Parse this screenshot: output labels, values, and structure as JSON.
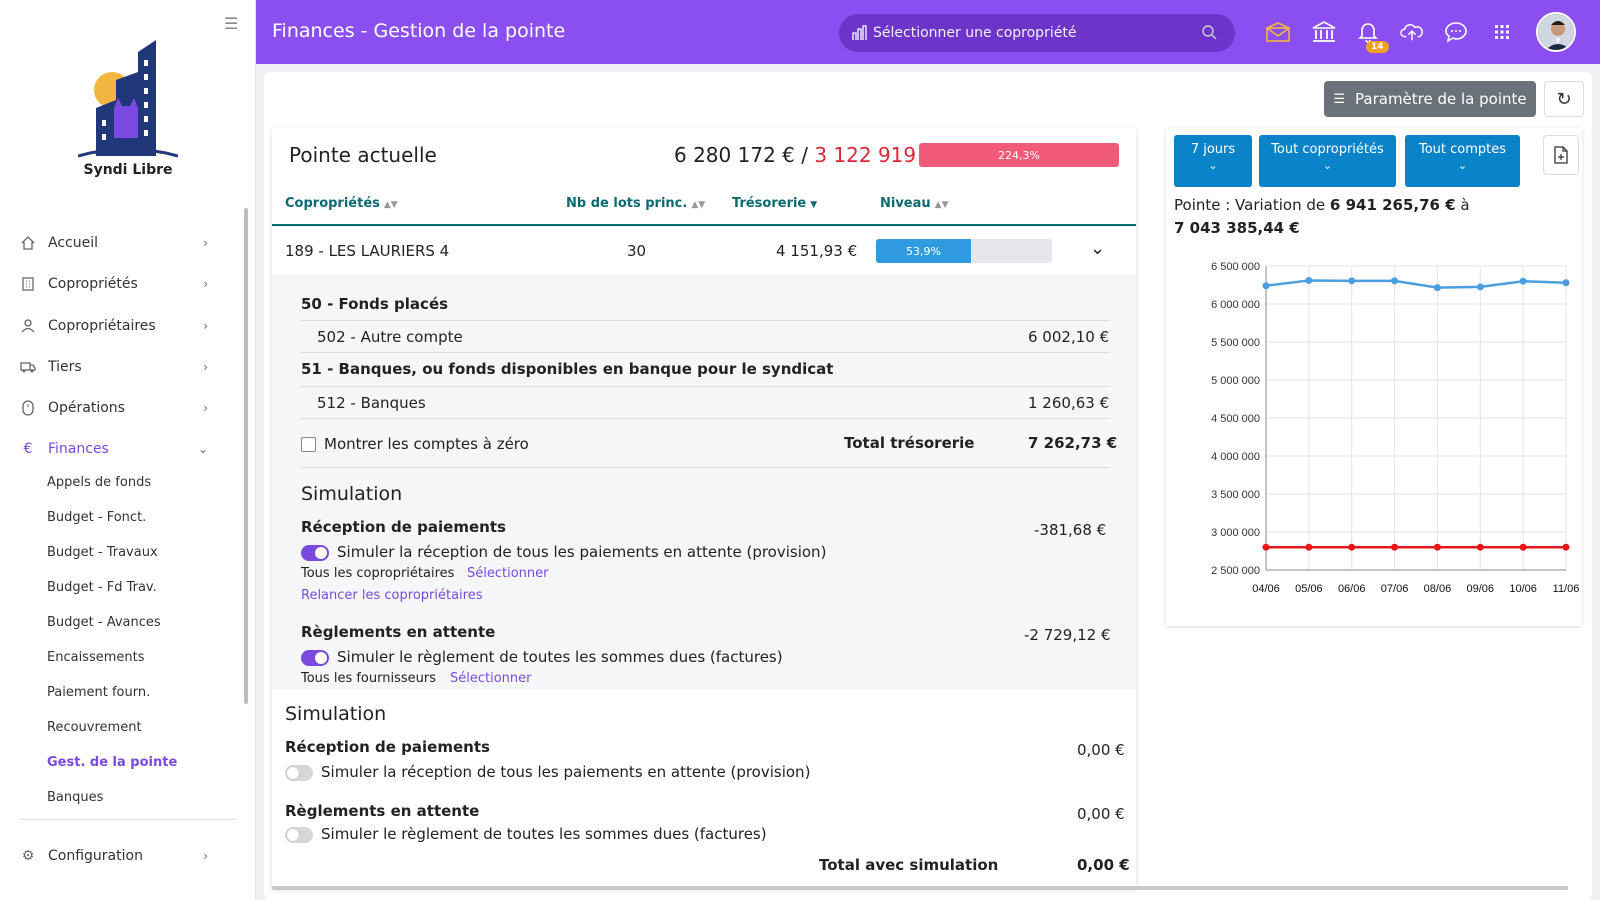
{
  "sidebar": {
    "brand": "Syndi Libre",
    "items": [
      {
        "label": "Accueil",
        "icon": "home-icon"
      },
      {
        "label": "Copropriétés",
        "icon": "building-icon"
      },
      {
        "label": "Copropriétaires",
        "icon": "user-icon"
      },
      {
        "label": "Tiers",
        "icon": "truck-icon"
      },
      {
        "label": "Opérations",
        "icon": "mouse-icon"
      },
      {
        "label": "Finances",
        "icon": "euro-icon"
      }
    ],
    "finances_sub": [
      "Appels de fonds",
      "Budget - Fonct.",
      "Budget - Travaux",
      "Budget - Fd Trav.",
      "Budget - Avances",
      "Encaissements",
      "Paiement fourn.",
      "Recouvrement",
      "Gest. de la pointe",
      "Banques"
    ],
    "config": "Configuration"
  },
  "header": {
    "title": "Finances - Gestion de la pointe",
    "search_placeholder": "Sélectionner une copropriété",
    "notif_count": "14"
  },
  "toolbar": {
    "param_label": "Paramètre de la pointe"
  },
  "pointe": {
    "title": "Pointe actuelle",
    "total_black": "6 280 172 €",
    "sep": " / ",
    "total_red": "3 122 919 €",
    "percent": "224,3%",
    "percent_value": 224.3
  },
  "table": {
    "headers": [
      "Copropriétés",
      "Nb de lots princ.",
      "Trésorerie",
      "Niveau"
    ],
    "row": {
      "name": "189 - LES LAURIERS 4",
      "lots": "30",
      "tresorerie": "4 151,93 €",
      "niveau": "53,9%",
      "niveau_value": 53.9
    }
  },
  "detail": {
    "group1": "50 - Fonds placés",
    "acc1": "502 - Autre compte",
    "acc1_val": "6 002,10 €",
    "group2": "51 - Banques, ou fonds disponibles en banque pour le syndicat",
    "acc2": "512 - Banques",
    "acc2_val": "1 260,63 €",
    "show_zero": "Montrer les comptes à zéro",
    "total_label": "Total trésorerie",
    "total_val": "7 262,73 €"
  },
  "sim_inner": {
    "title": "Simulation",
    "recv_title": "Réception de paiements",
    "recv_val": "-381,68 €",
    "recv_toggle": "Simuler la réception de tous les paiements en attente (provision)",
    "recv_scope": "Tous les copropriétaires",
    "select": "Sélectionner",
    "relance": "Relancer les copropriétaires",
    "pay_title": "Règlements en attente",
    "pay_val": "-2 729,12 €",
    "pay_toggle": "Simuler le règlement de toutes les sommes dues (factures)",
    "pay_scope": "Tous les fournisseurs"
  },
  "sim_outer": {
    "title": "Simulation",
    "recv_title": "Réception de paiements",
    "recv_val": "0,00 €",
    "recv_toggle": "Simuler la réception de tous les paiements en attente (provision)",
    "pay_title": "Règlements en attente",
    "pay_val": "0,00 €",
    "pay_toggle": "Simuler le règlement de toutes les sommes dues (factures)",
    "total_label": "Total avec simulation",
    "total_val": "0,00 €"
  },
  "filters": {
    "days": "7 jours",
    "coprop": "Tout copropriétés",
    "comptes": "Tout comptes"
  },
  "variation": {
    "prefix": "Pointe : Variation de ",
    "from": "6 941 265,76 €",
    "mid": " à",
    "to": "7 043 385,44 €"
  },
  "chart_data": {
    "type": "line",
    "x": [
      "04/06",
      "05/06",
      "06/06",
      "07/06",
      "08/06",
      "09/06",
      "10/06",
      "11/06"
    ],
    "ylim": [
      2500000,
      6500000
    ],
    "y_ticks": [
      "6 500 000",
      "6 000 000",
      "5 500 000",
      "5 000 000",
      "4 500 000",
      "4 000 000",
      "3 500 000",
      "3 000 000",
      "2 500 000"
    ],
    "grid": true,
    "series": [
      {
        "color": "#4a9fe0",
        "values": [
          6240000,
          6310000,
          6305000,
          6305000,
          6215000,
          6225000,
          6300000,
          6280000
        ]
      },
      {
        "color": "#e8141c",
        "values": [
          2800000,
          2800000,
          2800000,
          2800000,
          2800000,
          2800000,
          2800000,
          2800000
        ]
      }
    ]
  }
}
